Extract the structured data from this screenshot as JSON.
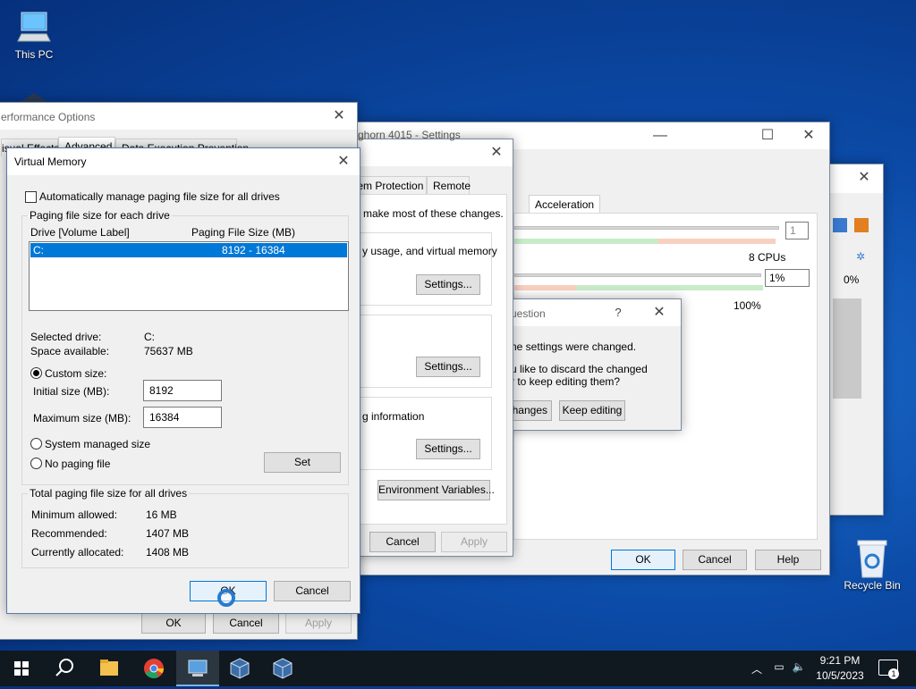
{
  "desktop": {
    "this_pc_label": "This PC",
    "recycle_bin_label": "Recycle Bin"
  },
  "perf_options": {
    "title": "Performance Options",
    "title_visible": "erformance Options",
    "tabs": [
      "isual Effects",
      "Advanced",
      "Data Execution Prevention"
    ],
    "ok": "OK",
    "cancel": "Cancel",
    "apply": "Apply"
  },
  "sys_props": {
    "title_visible": "ghorn 4015 - Settings",
    "tab_protection": "tem Protection",
    "tab_remote": "Remote",
    "intro": "make most of these changes.",
    "perf_desc": "y usage, and virtual memory",
    "startup_desc": "g information",
    "settings_btn": "Settings...",
    "env_vars_btn": "Environment Variables...",
    "cancel": "Cancel",
    "apply": "Apply"
  },
  "vm_settings": {
    "tab_acceleration": "Acceleration",
    "cpu_count_value": "1",
    "cpus_label": "8 CPUs",
    "exec_cap_value": "1%",
    "pct_100": "100%",
    "right_pct": "0%",
    "ok": "OK",
    "cancel": "Cancel",
    "help": "Help"
  },
  "question_dialog": {
    "title_visible": "uestion",
    "help_glyph": "?",
    "line1": "ne settings were changed.",
    "line2": "u like to discard the changed",
    "line3": "r to keep editing them?",
    "discard_btn": "changes",
    "keep_btn": "Keep editing"
  },
  "virtual_memory": {
    "title": "Virtual Memory",
    "auto_manage_label": "Automatically manage paging file size for all drives",
    "auto_manage_checked": false,
    "group_each_drive": "Paging file size for each drive",
    "col_drive": "Drive  [Volume Label]",
    "col_size": "Paging File Size (MB)",
    "drives": [
      {
        "drive": "C:",
        "size": "8192 - 16384"
      }
    ],
    "selected_drive_label": "Selected drive:",
    "selected_drive_value": "C:",
    "space_available_label": "Space available:",
    "space_available_value": "75637 MB",
    "custom_size_label": "Custom size:",
    "initial_size_label": "Initial size (MB):",
    "initial_size_value": "8192",
    "max_size_label": "Maximum size (MB):",
    "max_size_value": "16384",
    "system_managed_label": "System managed size",
    "no_paging_label": "No paging file",
    "set_btn": "Set",
    "selected_option": "custom",
    "group_total": "Total paging file size for all drives",
    "min_allowed_label": "Minimum allowed:",
    "min_allowed_value": "16 MB",
    "recommended_label": "Recommended:",
    "recommended_value": "1407 MB",
    "currently_allocated_label": "Currently allocated:",
    "currently_allocated_value": "1408 MB",
    "ok": "OK",
    "cancel": "Cancel"
  },
  "taskbar": {
    "time": "9:21 PM",
    "date": "10/5/2023",
    "notification_count": "1",
    "icons": [
      "start-icon",
      "search-icon",
      "file-explorer-icon",
      "chrome-icon",
      "system-properties-icon",
      "virtualbox-icon",
      "virtualbox-icon-2"
    ]
  },
  "colors": {
    "accent": "#0078d7",
    "selection": "#0078d7",
    "taskbar": "#101820"
  }
}
